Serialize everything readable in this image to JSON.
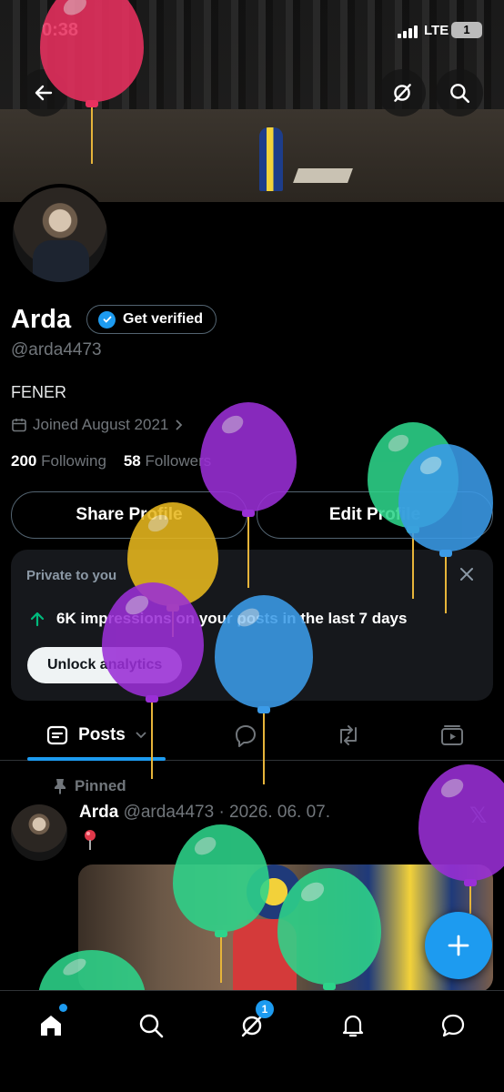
{
  "status_bar": {
    "time": "0:38",
    "network": "LTE",
    "battery": "1"
  },
  "header": {
    "back_icon": "arrow-left-icon",
    "grok_icon": "grok-icon",
    "search_icon": "search-icon"
  },
  "profile": {
    "name": "Arda",
    "verify_label": "Get verified",
    "handle": "@arda4473",
    "bio": "FENER",
    "joined": "Joined August 2021",
    "following_count": "200",
    "following_label": "Following",
    "followers_count": "58",
    "followers_label": "Followers"
  },
  "actions": {
    "share": "Share Profile",
    "edit": "Edit Profile"
  },
  "analytics_card": {
    "private_label": "Private to you",
    "impressions_text": "6K impressions on your posts in the last 7 days",
    "unlock_label": "Unlock analytics"
  },
  "tabs": {
    "posts": "Posts"
  },
  "pinned_post": {
    "pinned_label": "Pinned",
    "author": "Arda",
    "meta": "@arda4473 · 2026. 06. 07."
  },
  "nav": {
    "messages_badge": "1"
  },
  "colors": {
    "accent": "#1d9bf0",
    "background": "#000000",
    "muted": "#71767b"
  },
  "decor": {
    "balloons": [
      {
        "color": "#e8305f",
        "name": "red"
      },
      {
        "color": "#9a2fd6",
        "name": "purple"
      },
      {
        "color": "#2dd48a",
        "name": "green"
      },
      {
        "color": "#3b9be8",
        "name": "blue"
      },
      {
        "color": "#e8b81e",
        "name": "yellow"
      }
    ]
  }
}
